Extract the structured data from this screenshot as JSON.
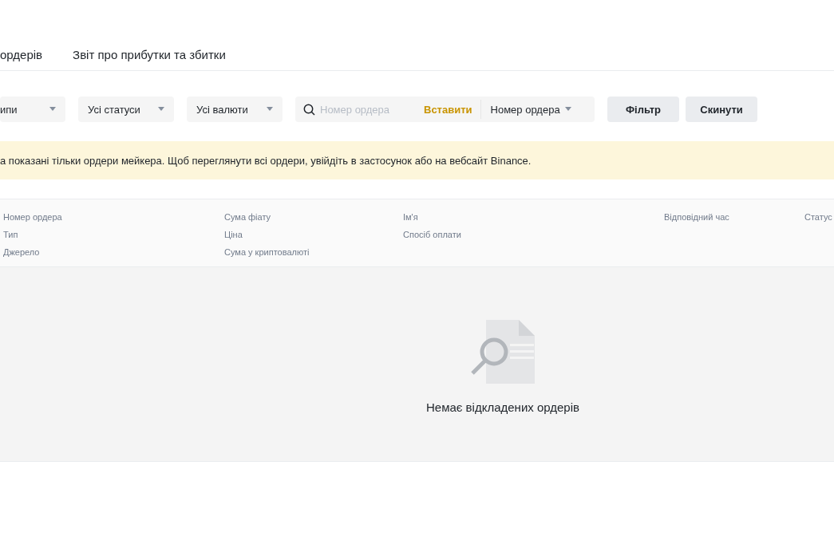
{
  "tabs": [
    {
      "label": "ордерів"
    },
    {
      "label": "Звіт про прибутки та збитки"
    }
  ],
  "filters": [
    {
      "kind": "dropdown",
      "label": "ипи"
    },
    {
      "kind": "dropdown",
      "label": "Усі статуси"
    },
    {
      "kind": "dropdown",
      "label": "Усі валюти"
    },
    {
      "kind": "search",
      "placeholder": "Номер ордера",
      "paste": "Вставити",
      "field": "Номер ордера"
    },
    {
      "kind": "button",
      "label": "Фільтр"
    },
    {
      "kind": "button",
      "label": "Скинути"
    }
  ],
  "notice": "а показані тільки ордери мейкера. Щоб переглянути всі ордери, увійдіть в застосунок або на вебсайт Binance.",
  "table": {
    "columns": [
      [
        "Номер ордера",
        "Тип",
        "Джерело"
      ],
      [
        "Сума фіату",
        "Ціна",
        "Сума у криптовалюті"
      ],
      [
        "Ім'я",
        "Спосіб оплати"
      ],
      [
        "Відповідний час"
      ],
      [
        "Статус"
      ]
    ],
    "empty": "Немає відкладених ордерів"
  }
}
